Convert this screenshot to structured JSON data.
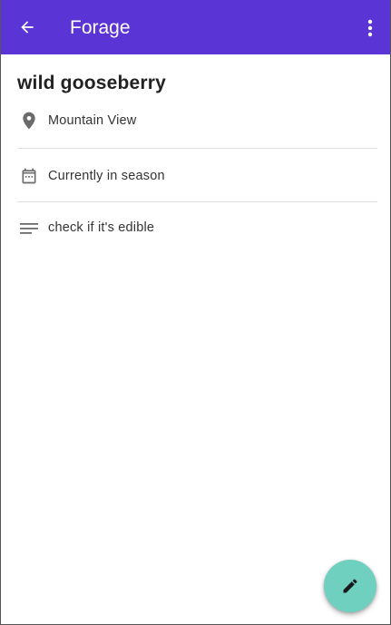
{
  "app_bar": {
    "title": "Forage",
    "background_color": "#5b34d6",
    "back_icon": "arrow-back-icon",
    "menu_icon": "more-vert-icon"
  },
  "item": {
    "title": "wild gooseberry",
    "location": {
      "icon": "location-pin-icon",
      "text": "Mountain View"
    },
    "season": {
      "icon": "calendar-icon",
      "text": "Currently in season"
    },
    "notes": {
      "icon": "notes-icon",
      "text": "check if it's edible"
    }
  },
  "fab": {
    "icon": "edit-pencil-icon",
    "color": "#6fd0bf"
  }
}
